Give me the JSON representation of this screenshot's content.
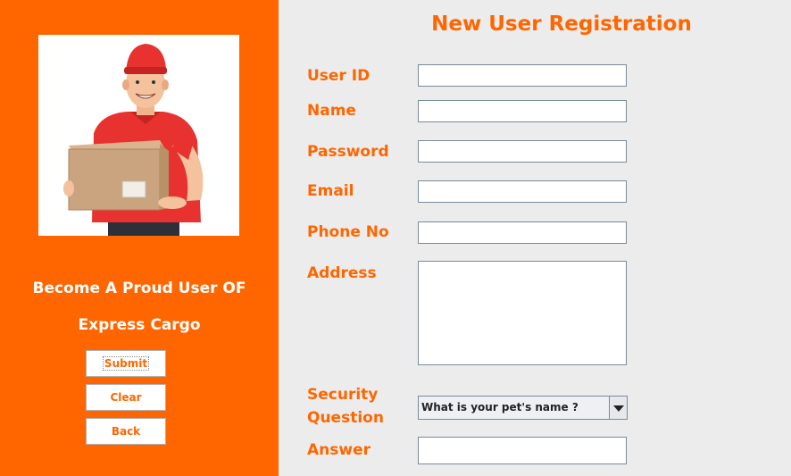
{
  "colors": {
    "accent": "#ff6600",
    "panel_bg": "#ececec",
    "field_bg": "#ffffff"
  },
  "sidebar": {
    "illustration": "delivery-man-with-parcel",
    "promo_line1": "Become A Proud User OF",
    "promo_line2": "Express Cargo",
    "buttons": {
      "submit": "Submit",
      "clear": "Clear",
      "back": "Back"
    }
  },
  "form": {
    "title": "New User Registration",
    "labels": {
      "user_id": "User ID",
      "name": "Name",
      "password": "Password",
      "email": "Email",
      "phone": "Phone No",
      "address": "Address",
      "security_line1": "Security",
      "security_line2": "Question",
      "answer": "Answer"
    },
    "values": {
      "user_id": "",
      "name": "",
      "password": "",
      "email": "",
      "phone": "",
      "address": "",
      "answer": ""
    },
    "security_question": {
      "selected": "What is your pet's name ?"
    }
  }
}
